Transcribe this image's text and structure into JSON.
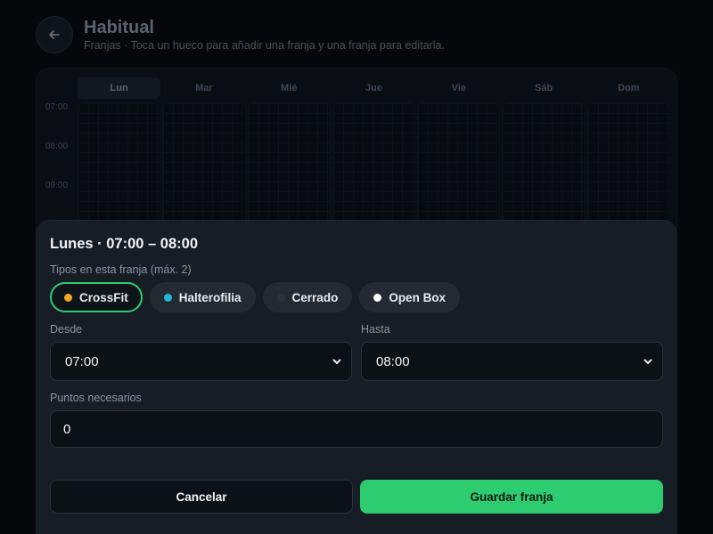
{
  "page": {
    "title": "Habitual",
    "subtitle": "Franjas · Toca un hueco para añadir una franja y una franja para editarla."
  },
  "schedule": {
    "days": [
      "Lun",
      "Mar",
      "Mié",
      "Jue",
      "Vie",
      "Sáb",
      "Dom"
    ],
    "active_day": "Lun",
    "times": [
      "07:00",
      "08:00",
      "09:00"
    ]
  },
  "sheet": {
    "title": "Lunes · 07:00 – 08:00",
    "types_label": "Tipos en esta franja (máx. 2)",
    "types": [
      {
        "label": "CrossFit",
        "color": "#f5a623",
        "selected": true
      },
      {
        "label": "Halterofilia",
        "color": "#1fb8d6",
        "selected": false
      },
      {
        "label": "Cerrado",
        "color": "#2b323c",
        "selected": false
      },
      {
        "label": "Open Box",
        "color": "#ffffff",
        "selected": false
      }
    ],
    "from_label": "Desde",
    "from_value": "07:00",
    "to_label": "Hasta",
    "to_value": "08:00",
    "points_label": "Puntos necesarios",
    "points_value": "0",
    "cancel_label": "Cancelar",
    "save_label": "Guardar franja"
  },
  "colors": {
    "accent": "#2ecc71",
    "sheet_bg": "#171d25"
  },
  "icons": {
    "back": "arrow-left-icon",
    "select": "chevron-down-icon"
  }
}
